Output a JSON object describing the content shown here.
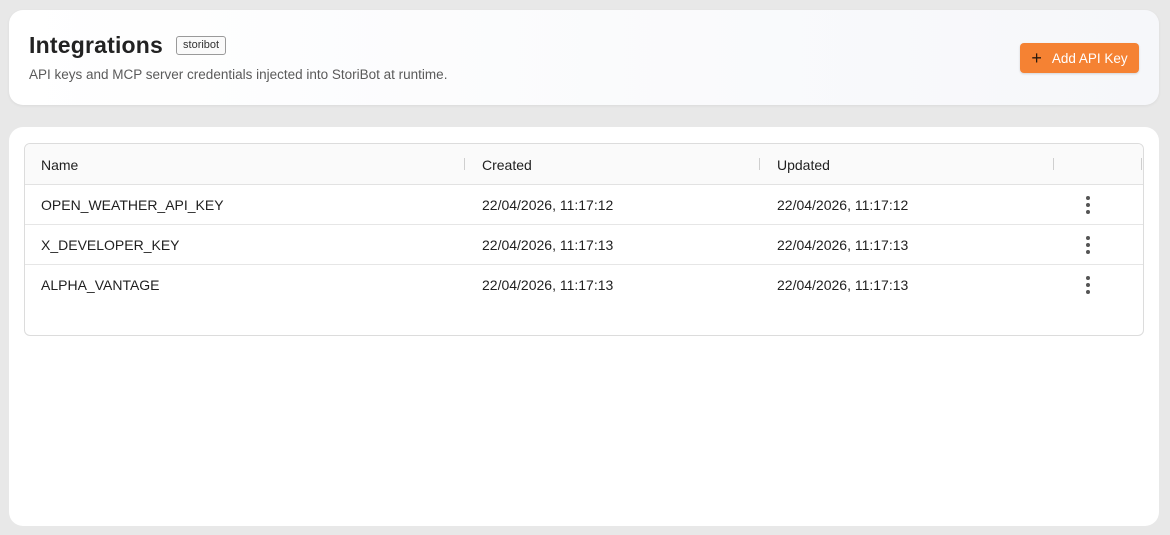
{
  "header": {
    "title": "Integrations",
    "badge": "storibot",
    "subtitle": "API keys and MCP server credentials injected into StoriBot at runtime.",
    "add_button_label": "Add API Key",
    "add_button_icon": "plus-icon",
    "accent_color": "#f58233"
  },
  "table": {
    "columns": [
      "Name",
      "Created",
      "Updated",
      ""
    ],
    "rows": [
      {
        "name": "OPEN_WEATHER_API_KEY",
        "created": "22/04/2026, 11:17:12",
        "updated": "22/04/2026, 11:17:12"
      },
      {
        "name": "X_DEVELOPER_KEY",
        "created": "22/04/2026, 11:17:13",
        "updated": "22/04/2026, 11:17:13"
      },
      {
        "name": "ALPHA_VANTAGE",
        "created": "22/04/2026, 11:17:13",
        "updated": "22/04/2026, 11:17:13"
      }
    ],
    "row_action_icon": "more-vertical-icon"
  }
}
